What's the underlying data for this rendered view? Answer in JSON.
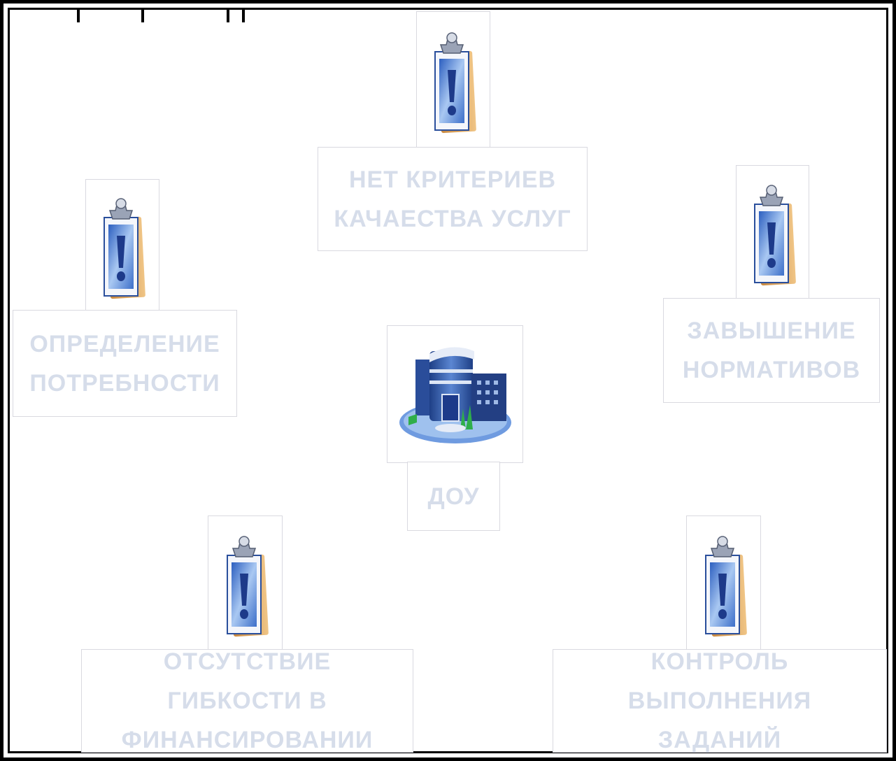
{
  "diagram": {
    "center": {
      "label": "ДОУ",
      "icon": "building-icon"
    },
    "nodes": [
      {
        "id": "top",
        "label": "Нет критериев качаества услуг",
        "icon": "clipboard-alert-icon"
      },
      {
        "id": "left",
        "label": "Определение потребности",
        "icon": "clipboard-alert-icon"
      },
      {
        "id": "right",
        "label": "Завышение нормативов",
        "icon": "clipboard-alert-icon"
      },
      {
        "id": "bottom-left",
        "label": "Отсутствие гибкости в финансировании",
        "icon": "clipboard-alert-icon"
      },
      {
        "id": "bottom-right",
        "label": "Контроль выполнения заданий",
        "icon": "clipboard-alert-icon"
      }
    ]
  },
  "colors": {
    "frame": "#000000",
    "label_text": "#d6ddea",
    "clipboard_board": "#d49a55",
    "clipboard_paper": "#4a7fd0",
    "exclamation": "#1d3a8a",
    "building_body": "#2f57a8",
    "building_glass": "#9fc1ee"
  }
}
